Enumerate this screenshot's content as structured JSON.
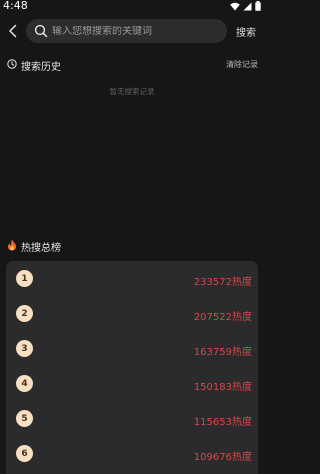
{
  "status_bar": {
    "time": "4:48"
  },
  "search": {
    "placeholder": "输入您想搜索的关键词",
    "button_label": "搜索"
  },
  "history": {
    "title": "搜索历史",
    "clear_label": "清除记录",
    "empty_text": "暂无搜索记录"
  },
  "hot": {
    "title": "热搜总榜",
    "items": [
      {
        "rank": "1",
        "heat": "233572热度"
      },
      {
        "rank": "2",
        "heat": "207522热度"
      },
      {
        "rank": "3",
        "heat": "163759热度"
      },
      {
        "rank": "4",
        "heat": "150183热度"
      },
      {
        "rank": "5",
        "heat": "115653热度"
      },
      {
        "rank": "6",
        "heat": "109676热度"
      }
    ]
  },
  "colors": {
    "background": "#161616",
    "card": "#2b2a2c",
    "heat_text": "#d64848",
    "rank_badge": "#f7dfc2"
  }
}
